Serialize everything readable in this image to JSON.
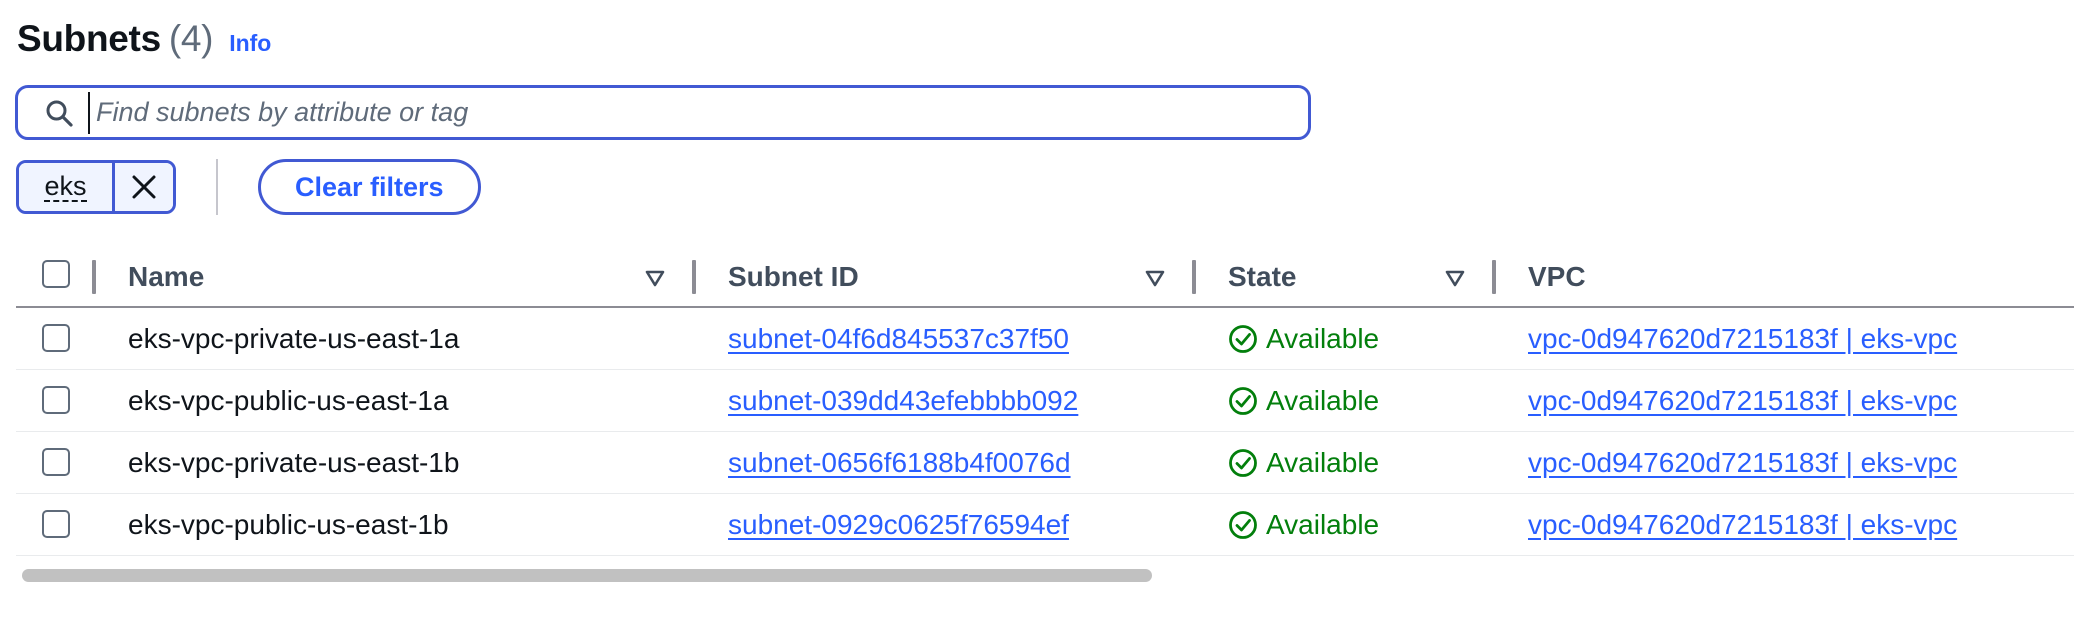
{
  "header": {
    "title": "Subnets",
    "count": "(4)",
    "info_label": "Info"
  },
  "search": {
    "placeholder": "Find subnets by attribute or tag",
    "value": ""
  },
  "filters": {
    "tokens": [
      {
        "label": "eks"
      }
    ],
    "clear_label": "Clear filters"
  },
  "table": {
    "columns": [
      {
        "label": "Name",
        "sortable": true
      },
      {
        "label": "Subnet ID",
        "sortable": true
      },
      {
        "label": "State",
        "sortable": true
      },
      {
        "label": "VPC",
        "sortable": false
      }
    ],
    "rows": [
      {
        "name": "eks-vpc-private-us-east-1a",
        "subnet_id": "subnet-04f6d845537c37f50",
        "state": "Available",
        "vpc": "vpc-0d947620d7215183f | eks-vpc"
      },
      {
        "name": "eks-vpc-public-us-east-1a",
        "subnet_id": "subnet-039dd43efebbbb092",
        "state": "Available",
        "vpc": "vpc-0d947620d7215183f | eks-vpc"
      },
      {
        "name": "eks-vpc-private-us-east-1b",
        "subnet_id": "subnet-0656f6188b4f0076d",
        "state": "Available",
        "vpc": "vpc-0d947620d7215183f | eks-vpc"
      },
      {
        "name": "eks-vpc-public-us-east-1b",
        "subnet_id": "subnet-0929c0625f76594ef",
        "state": "Available",
        "vpc": "vpc-0d947620d7215183f | eks-vpc"
      }
    ]
  },
  "icons": {
    "search": "search-icon",
    "dismiss": "close-icon",
    "sort": "caret-down-filled-icon",
    "status": "status-positive-icon"
  },
  "colors": {
    "accent": "#295eff",
    "focus_border": "#4159d3",
    "success": "#037f0c",
    "header_text": "#414d5c"
  }
}
